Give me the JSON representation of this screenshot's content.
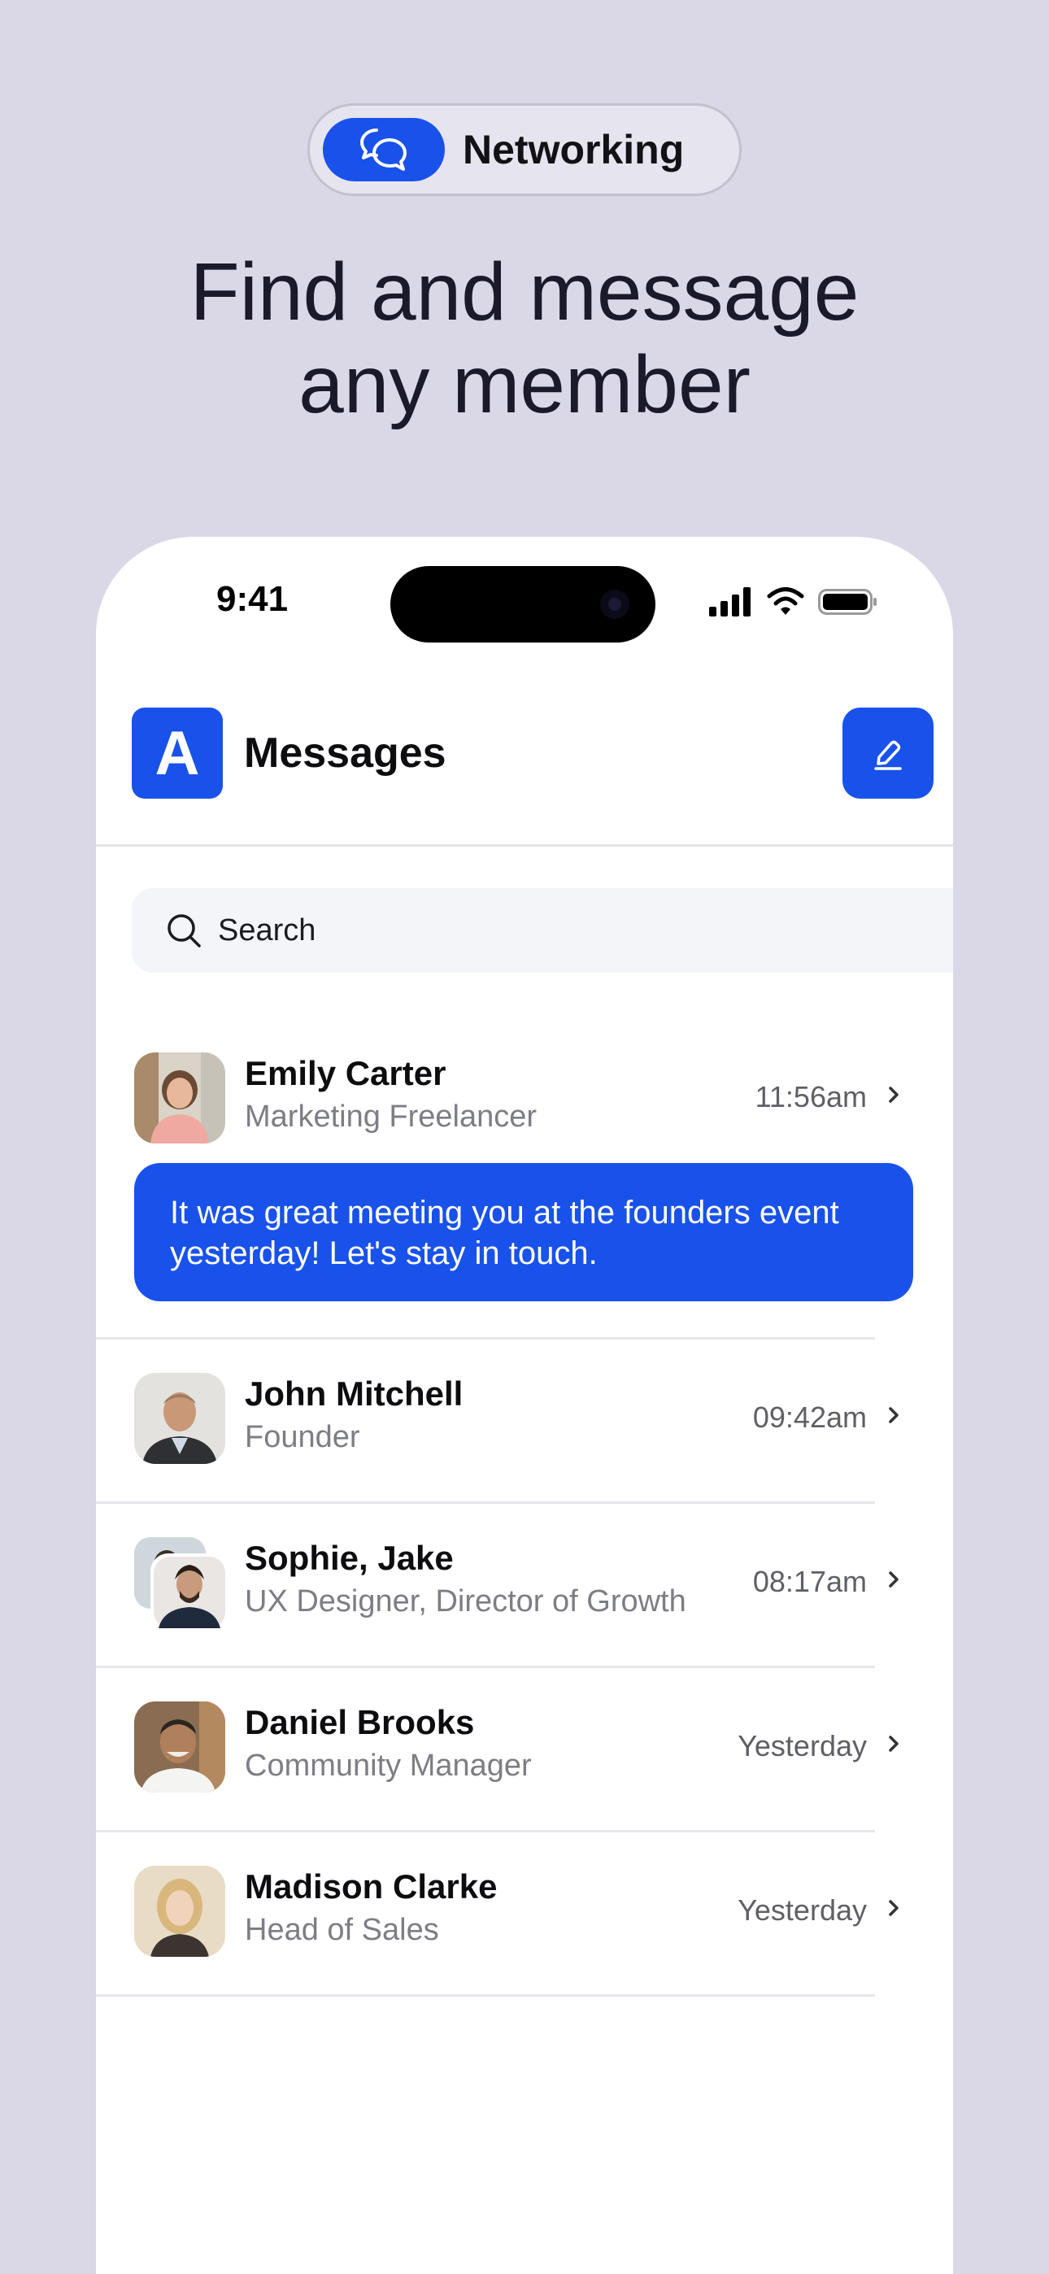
{
  "promo": {
    "badge_label": "Networking",
    "headline_line1": "Find and message",
    "headline_line2": "any member"
  },
  "status_bar": {
    "time": "9:41"
  },
  "app": {
    "logo_letter": "A",
    "title": "Messages"
  },
  "search": {
    "placeholder": "Search"
  },
  "conversations": [
    {
      "name": "Emily Carter",
      "subtitle": "Marketing Freelancer",
      "time": "11:56am",
      "message_line1": "It was great meeting you at the founders event",
      "message_line2": "yesterday! Let's stay in touch."
    },
    {
      "name": "John Mitchell",
      "subtitle": "Founder",
      "time": "09:42am"
    },
    {
      "name": "Sophie, Jake",
      "subtitle": "UX Designer, Director of Growth",
      "time": "08:17am"
    },
    {
      "name": "Daniel Brooks",
      "subtitle": "Community Manager",
      "time": "Yesterday"
    },
    {
      "name": "Madison Clarke",
      "subtitle": "Head of Sales",
      "time": "Yesterday"
    }
  ],
  "colors": {
    "background": "#dad8e6",
    "accent": "#1952ea",
    "card": "#ffffff",
    "muted_text": "#7d7e84"
  },
  "icons": {
    "badge": "chat-bubbles-icon",
    "compose": "edit-pencil-icon",
    "search": "search-icon",
    "row": "chevron-right-icon"
  }
}
